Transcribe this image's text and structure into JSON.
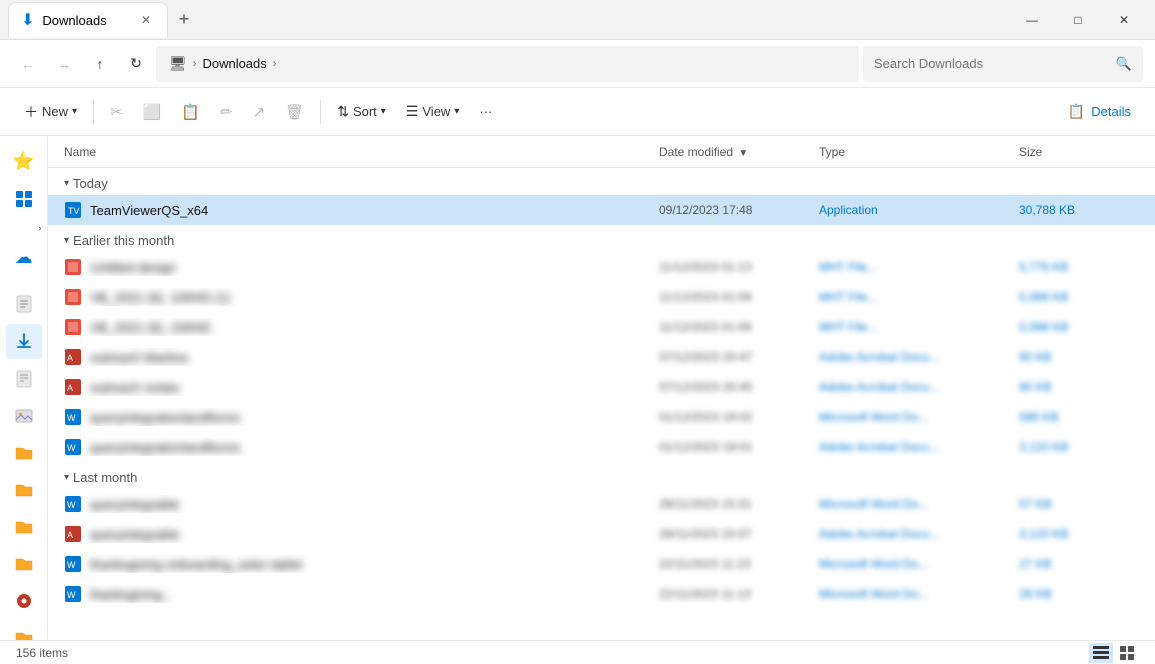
{
  "titleBar": {
    "tab": {
      "label": "Downloads",
      "icon": "⬇"
    },
    "newTabTitle": "+",
    "windowControls": {
      "minimize": "—",
      "maximize": "□",
      "close": "✕"
    }
  },
  "navBar": {
    "back": "←",
    "forward": "→",
    "up": "↑",
    "refresh": "↻",
    "addressIcon": "🖥",
    "addressParts": [
      "Downloads"
    ],
    "searchPlaceholder": "Search Downloads"
  },
  "toolbar": {
    "new": "New",
    "sort": "Sort",
    "view": "View",
    "more": "···",
    "details": "Details",
    "buttons": [
      {
        "icon": "✂",
        "label": "",
        "disabled": true
      },
      {
        "icon": "⬜",
        "label": "",
        "disabled": true
      },
      {
        "icon": "📋",
        "label": "",
        "disabled": true
      },
      {
        "icon": "✏",
        "label": "",
        "disabled": true
      },
      {
        "icon": "↗",
        "label": "",
        "disabled": true
      },
      {
        "icon": "🗑",
        "label": "",
        "disabled": true
      }
    ]
  },
  "sidebar": {
    "items": [
      {
        "icon": "⭐",
        "active": false,
        "name": "quick-access"
      },
      {
        "icon": "🖼",
        "active": false,
        "name": "gallery"
      },
      {
        "icon": "☁",
        "active": false,
        "name": "onedrive",
        "hasExpand": true
      },
      {
        "icon": "📄",
        "active": false,
        "name": "documents"
      },
      {
        "icon": "⬇",
        "active": true,
        "name": "downloads"
      },
      {
        "icon": "📝",
        "active": false,
        "name": "notes"
      },
      {
        "icon": "🖼",
        "active": false,
        "name": "pictures"
      },
      {
        "icon": "📁",
        "active": false,
        "name": "folder1"
      },
      {
        "icon": "📁",
        "active": false,
        "name": "folder2"
      },
      {
        "icon": "📁",
        "active": false,
        "name": "folder3"
      },
      {
        "icon": "📁",
        "active": false,
        "name": "folder4"
      },
      {
        "icon": "🎵",
        "active": false,
        "name": "music"
      },
      {
        "icon": "📁",
        "active": false,
        "name": "folder5"
      }
    ]
  },
  "fileList": {
    "columns": {
      "name": "Name",
      "dateModified": "Date modified",
      "type": "Type",
      "size": "Size"
    },
    "sections": [
      {
        "title": "Today",
        "expanded": true,
        "files": [
          {
            "name": "TeamViewerQS_x64",
            "icon": "🖥",
            "iconColor": "#0078d4",
            "date": "09/12/2023 17:48",
            "type": "Application",
            "size": "30,788 KB",
            "blurDate": false,
            "blurType": false,
            "blurSize": false
          }
        ]
      },
      {
        "title": "Earlier this month",
        "expanded": true,
        "files": [
          {
            "name": "Untitled design",
            "icon": "🟥",
            "iconColor": "#e74c3c",
            "date": "11/12/2023 01:13",
            "type": "MHT File...",
            "size": "5,778 KB",
            "blurDate": true,
            "blurType": true,
            "blurSize": true
          },
          {
            "name": "VB_2021 (6), 100HD (1)",
            "icon": "🟥",
            "iconColor": "#e74c3c",
            "date": "11/12/2023 01:09",
            "type": "MHT File...",
            "size": "5,088 KB",
            "blurDate": true,
            "blurType": true,
            "blurSize": true
          },
          {
            "name": "VB_2021 (6), 100HD",
            "icon": "🟥",
            "iconColor": "#e74c3c",
            "date": "11/12/2023 01:06",
            "type": "MHT File...",
            "size": "5,088 KB",
            "blurDate": true,
            "blurType": true,
            "blurSize": true
          },
          {
            "name": "outreach Martina",
            "icon": "🔴",
            "iconColor": "#c0392b",
            "date": "07/12/2023 20:47",
            "type": "Adobe Acrobat Docu...",
            "size": "90 KB",
            "blurDate": true,
            "blurType": true,
            "blurSize": true
          },
          {
            "name": "outreach notaio",
            "icon": "🔴",
            "iconColor": "#c0392b",
            "date": "07/12/2023 20:45",
            "type": "Adobe Acrobat Docu...",
            "size": "90 KB",
            "blurDate": true,
            "blurType": true,
            "blurSize": true
          },
          {
            "name": "queryintegrationlandforms",
            "icon": "🔵",
            "iconColor": "#0078d4",
            "date": "01/12/2023 19:02",
            "type": "Microsoft Word Do...",
            "size": "586 KB",
            "blurDate": true,
            "blurType": true,
            "blurSize": true
          },
          {
            "name": "queryintegrationlandforms",
            "icon": "🔵",
            "iconColor": "#0078d4",
            "date": "01/12/2023 19:01",
            "type": "Adobe Acrobat Docu...",
            "size": "3,120 KB",
            "blurDate": true,
            "blurType": true,
            "blurSize": true
          }
        ]
      },
      {
        "title": "Last month",
        "expanded": true,
        "files": [
          {
            "name": "queryintegrable",
            "icon": "🔵",
            "iconColor": "#0078d4",
            "date": "28/11/2023 15:31",
            "type": "Microsoft Word Do...",
            "size": "57 KB",
            "blurDate": true,
            "blurType": true,
            "blurSize": true
          },
          {
            "name": "queryintegrable",
            "icon": "🔴",
            "iconColor": "#c0392b",
            "date": "28/11/2023 15:07",
            "type": "Adobe Acrobat Docu...",
            "size": "3,120 KB",
            "blurDate": true,
            "blurType": true,
            "blurSize": true
          },
          {
            "name": "thanksgiving onboarding_aster tablet",
            "icon": "🔵",
            "iconColor": "#0078d4",
            "date": "22/11/2023 11:23",
            "type": "Microsoft Word Do...",
            "size": "27 KB",
            "blurDate": true,
            "blurType": true,
            "blurSize": true
          },
          {
            "name": "thanksgiving...",
            "icon": "🔵",
            "iconColor": "#0078d4",
            "date": "22/11/2023 11:13",
            "type": "Microsoft Word Do...",
            "size": "28 KB",
            "blurDate": true,
            "blurType": true,
            "blurSize": true
          }
        ]
      }
    ]
  },
  "statusBar": {
    "count": "156 items"
  }
}
